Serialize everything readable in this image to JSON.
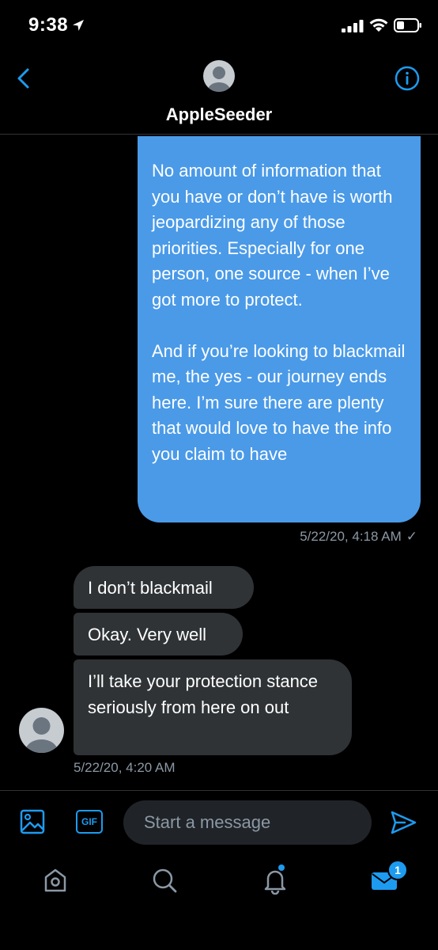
{
  "status_bar": {
    "time": "9:38",
    "icons": [
      "location-arrow-icon",
      "signal-icon",
      "wifi-icon",
      "battery-icon"
    ]
  },
  "header": {
    "contact_name": "AppleSeeder",
    "back_icon": "chevron-left-icon",
    "info_icon": "info-icon"
  },
  "conversation": {
    "sent": {
      "paragraph_1": "No amount of information that you have or don’t have is worth jeopardizing any of those priorities. Especially for one person, one source - when I’ve got more to protect.",
      "paragraph_2": "And if you’re looking to blackmail me, the yes - our journey ends here. I’m sure there are plenty that would love to have the info you claim to have",
      "timestamp": "5/22/20, 4:18 AM",
      "receipt": "✓"
    },
    "received": {
      "messages": [
        "I don’t blackmail",
        "Okay. Very well",
        "I’ll take your protection stance seriously from here on out"
      ],
      "timestamp": "5/22/20, 4:20 AM"
    }
  },
  "composer": {
    "placeholder": "Start a message",
    "gif_label": "GIF"
  },
  "tabbar": {
    "tabs": [
      "home",
      "search",
      "notifications",
      "messages"
    ],
    "messages_badge": "1"
  },
  "colors": {
    "accent": "#1d9bf0",
    "sent_bubble": "#4a9ae8",
    "received_bubble": "#2f3336",
    "muted_text": "#8b98a5",
    "background": "#000000"
  }
}
